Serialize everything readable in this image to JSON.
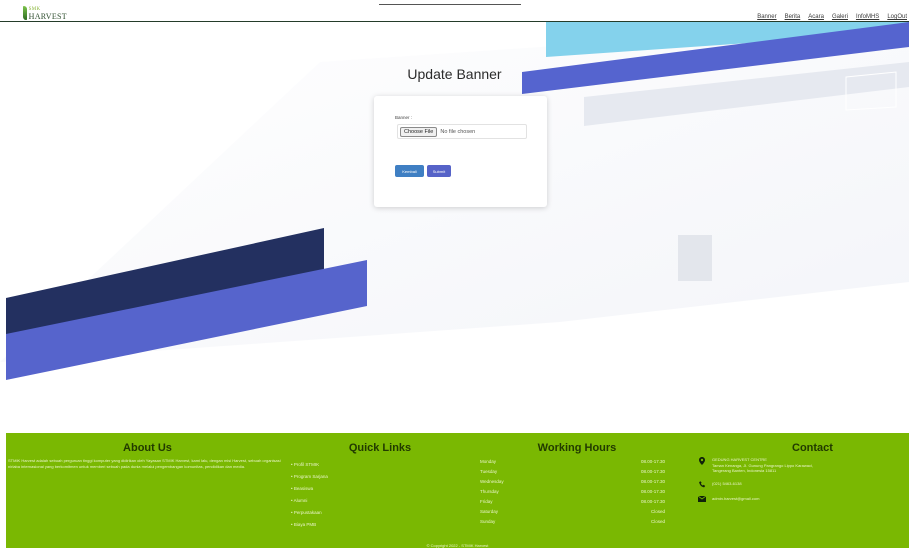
{
  "navbar": {
    "logo_top": "SMK",
    "logo_text": "HARVEST",
    "links": [
      "Banner",
      "Berita",
      "Acara",
      "Galeri",
      "InfoMHS",
      "LogOut"
    ]
  },
  "form": {
    "title": "Update Banner",
    "field_label": "Banner :",
    "file_button": "Choose File",
    "file_status": "No file chosen",
    "back_label": "Kembali",
    "submit_label": "Submit"
  },
  "footer": {
    "about": {
      "heading": "About Us",
      "text": "STMIK Harvest adalah sebuah perguruan tinggi komputer yang didirikan oleh Yayasan STMIK Harvest, kami lalu, dengan misi Harvest, sebuah organisasi nirlaba internasional yang berkomitmen untuk memberi sebuah pada dunia melalui pengembangan komunitas, pendidikan dan media."
    },
    "quick_links": {
      "heading": "Quick Links",
      "items": [
        "• Profil STMIK",
        "• Program Sarjana",
        "• Beasiswa",
        "• Alumni",
        "• Perpustakaan",
        "• Biaya PMB"
      ]
    },
    "hours": {
      "heading": "Working Hours",
      "rows": [
        {
          "day": "Monday",
          "time": "08.00-17.30"
        },
        {
          "day": "Tuesday",
          "time": "08.00-17.30"
        },
        {
          "day": "Wednesday",
          "time": "08.00-17.30"
        },
        {
          "day": "Thursday",
          "time": "08.00-17.30"
        },
        {
          "day": "Friday",
          "time": "08.00-17.30"
        },
        {
          "day": "Saturday",
          "time": "Closed"
        },
        {
          "day": "Sunday",
          "time": "Closed"
        }
      ]
    },
    "contact": {
      "heading": "Contact",
      "address_line1": "GEDUNG HARVEST CENTRE",
      "address_line2": "Taman Kenanga, Jl. Gunung Pangrango Lippo Karawaci,",
      "address_line3": "Tangerang Banten, Indonesia 15811",
      "phone": "(021) 5463-6138",
      "email": "admin.harvest@gmail.com"
    },
    "copyright": "© Copyright 2022 - STMIK Harvest"
  }
}
